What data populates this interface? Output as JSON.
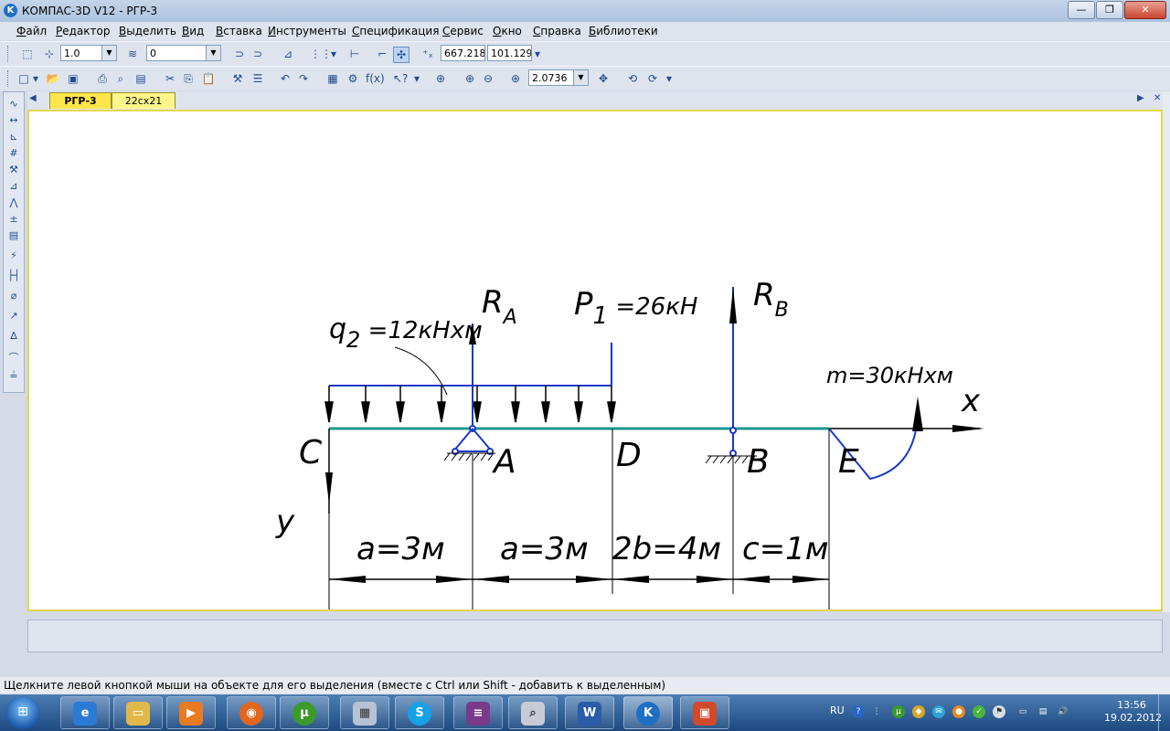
{
  "window": {
    "title": "КОМПАС-3D V12 - РГР-3",
    "app_icon": "K"
  },
  "menu": [
    "Файл",
    "Редактор",
    "Выделить",
    "Вид",
    "Вставка",
    "Инструменты",
    "Спецификация",
    "Сервис",
    "Окно",
    "Справка",
    "Библиотеки"
  ],
  "toolbar1": {
    "line_scale": "1.0",
    "layer": "0",
    "coord_x": "667.218",
    "coord_y": "101.129"
  },
  "toolbar2": {
    "zoom": "2.0736"
  },
  "tabs": [
    "РГР-3",
    "22сх21"
  ],
  "drawing": {
    "q_label_main": "q",
    "q_label_sub": "2",
    "q_label_rest": " =12кНхм",
    "ra_main": "R",
    "ra_sub": "A",
    "p1_main": "P",
    "p1_sub": "1",
    "p1_rest": " =26кН",
    "rb_main": "R",
    "rb_sub": "B",
    "m_label": "m=30кНхм",
    "x_axis": "x",
    "y_axis": "y",
    "point_c": "C",
    "point_a": "A",
    "point_d": "D",
    "point_b": "B",
    "point_e": "E",
    "dim1": "a=3м",
    "dim2": "a=3м",
    "dim3": "2b=4м",
    "dim4": "c=1м"
  },
  "status": "Щелкните левой кнопкой мыши на объекте для его выделения (вместе с Ctrl или Shift - добавить к выделенным)",
  "tray": {
    "lang": "RU",
    "time": "13:56",
    "date": "19.02.2012"
  },
  "colors": {
    "beam": "#1a9a8e",
    "support": "#1a38c8",
    "canvas_border": "#e8d74d",
    "taskbar": "#2d5f97"
  }
}
